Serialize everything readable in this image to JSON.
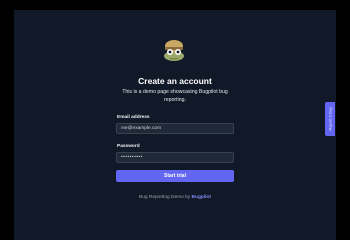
{
  "header": {
    "title": "Create an account",
    "subtitle": "This is a demo page showcasing Bugpilot bug reporting."
  },
  "form": {
    "email": {
      "label": "Email address",
      "value": "me@example.com"
    },
    "password": {
      "label": "Password",
      "value": "••••••••••"
    },
    "submit_label": "Start trial"
  },
  "footer": {
    "prefix": "Bug Reporting Demo by",
    "brand": "Bugpilot"
  },
  "sidebar_tab": {
    "label": "Report a bug"
  },
  "colors": {
    "background": "#111827",
    "accent": "#6366f1",
    "input_bg": "#1f2937"
  },
  "icons": {
    "logo": "frog-pilot-icon"
  }
}
